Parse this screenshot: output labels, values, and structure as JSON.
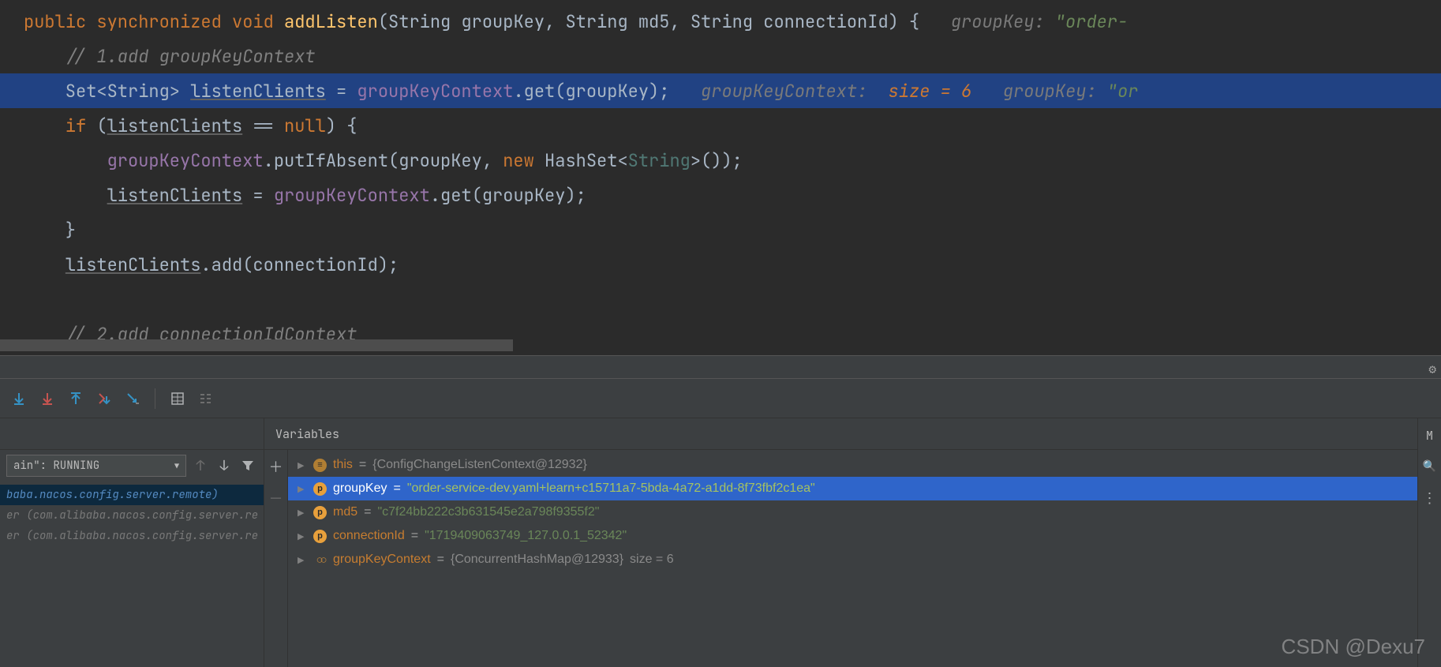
{
  "code": {
    "line1": {
      "kw1": "public ",
      "kw2": "synchronized ",
      "kw3": "void ",
      "method": "addListen",
      "params": "(String groupKey, String md5, String connectionId) {",
      "hint_label": "   groupKey: ",
      "hint_val": "\"order-"
    },
    "line2": "    // 1.add groupKeyContext",
    "line3": {
      "text1": "    Set<String> ",
      "var": "listenClients",
      "text2": " = ",
      "field": "groupKeyContext",
      "text3": ".get(groupKey);",
      "hint_ctx": "   groupKeyContext:",
      "hint_size": "  size = 6",
      "hint_grp": "   groupKey: ",
      "hint_grp_val": "\"or"
    },
    "line4": {
      "kw": "    if ",
      "open": "(",
      "var": "listenClients",
      "cmp": " == ",
      "null": "null",
      "close": ") {"
    },
    "line5": {
      "indent": "        ",
      "field": "groupKeyContext",
      "call": ".putIfAbsent(groupKey, ",
      "kw": "new ",
      "cls": "HashSet<",
      "generic": "String",
      "end": ">());"
    },
    "line6": {
      "indent": "        ",
      "var": "listenClients",
      "eq": " = ",
      "field": "groupKeyContext",
      "end": ".get(groupKey);"
    },
    "line7": "    }",
    "line8": {
      "indent": "    ",
      "var": "listenClients",
      "end": ".add(connectionId);"
    },
    "line10": "    // 2.add connectionIdContext"
  },
  "vars_title": "Variables",
  "frames": {
    "dropdown": "ain\": RUNNING",
    "items": [
      "baba.nacos.config.server.remote)",
      "er (com.alibaba.nacos.config.server.re",
      "er (com.alibaba.nacos.config.server.re"
    ]
  },
  "variables": [
    {
      "badge": "obj",
      "icon": "≡",
      "name": "this",
      "eq": " = ",
      "val": "{ConfigChangeListenContext@12932}",
      "str": "",
      "selected": false
    },
    {
      "badge": "p",
      "icon": "p",
      "name": "groupKey",
      "eq": " = ",
      "val": "",
      "str": "\"order-service-dev.yaml+learn+c15711a7-5bda-4a72-a1dd-8f73fbf2c1ea\"",
      "selected": true
    },
    {
      "badge": "p",
      "icon": "p",
      "name": "md5",
      "eq": " = ",
      "val": "",
      "str": "\"c7f24bb222c3b631545e2a798f9355f2\"",
      "selected": false
    },
    {
      "badge": "p",
      "icon": "p",
      "name": "connectionId",
      "eq": " = ",
      "val": "",
      "str": "\"1719409063749_127.0.0.1_52342\"",
      "selected": false
    },
    {
      "badge": "oo",
      "icon": "oo",
      "name": "groupKeyContext",
      "eq": " = ",
      "val": "{ConcurrentHashMap@12933}",
      "str": "",
      "extra": "  size = 6",
      "selected": false
    }
  ],
  "mark_label": "M",
  "watermark": "CSDN @Dexu7"
}
